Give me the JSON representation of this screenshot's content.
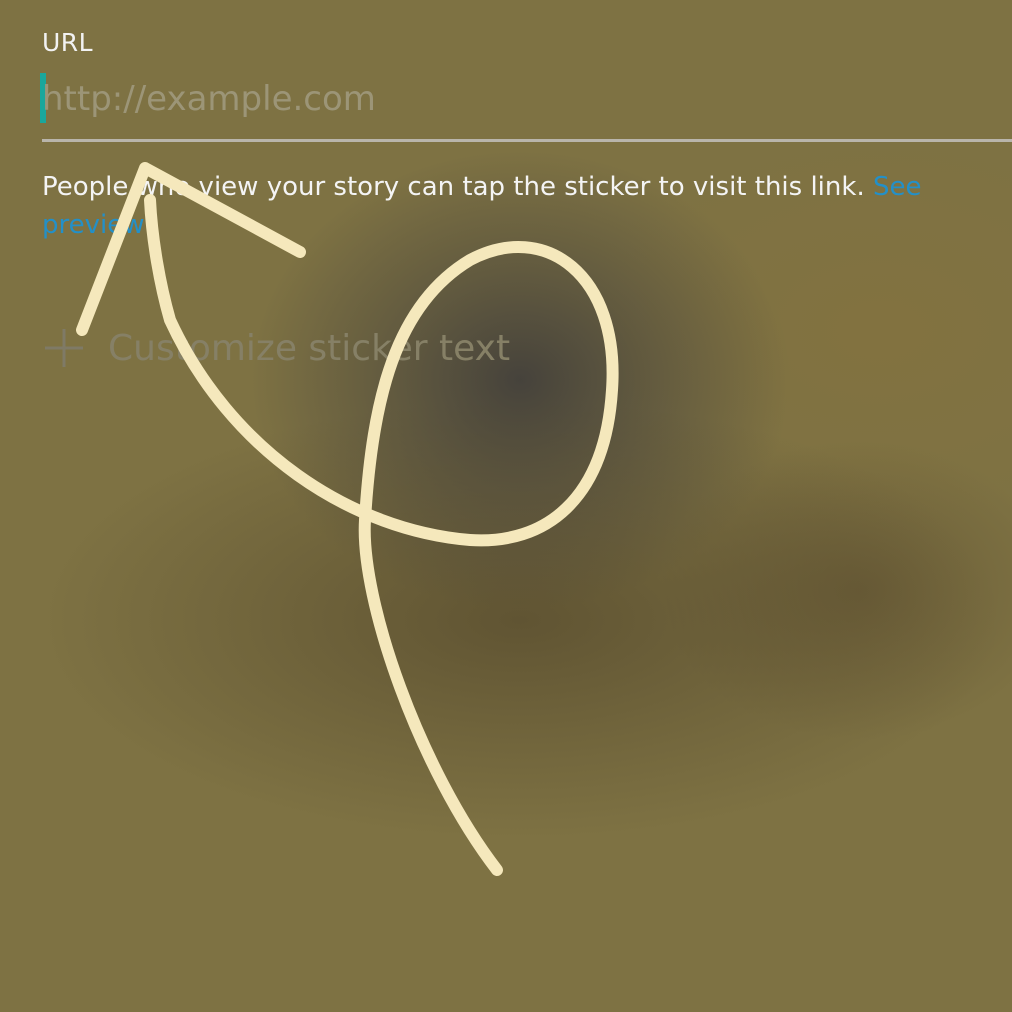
{
  "url_field": {
    "label": "URL",
    "placeholder": "http://example.com",
    "value": ""
  },
  "helper": {
    "text": "People who view your story can tap the sticker to visit this link.",
    "link_label": "See preview"
  },
  "customize": {
    "label": "Customize sticker text",
    "icon": "plus-icon"
  },
  "colors": {
    "background": "#7e7243",
    "accent": "#1aa79c",
    "link": "#2390c8",
    "doodle_stroke": "#f5e8bc"
  }
}
